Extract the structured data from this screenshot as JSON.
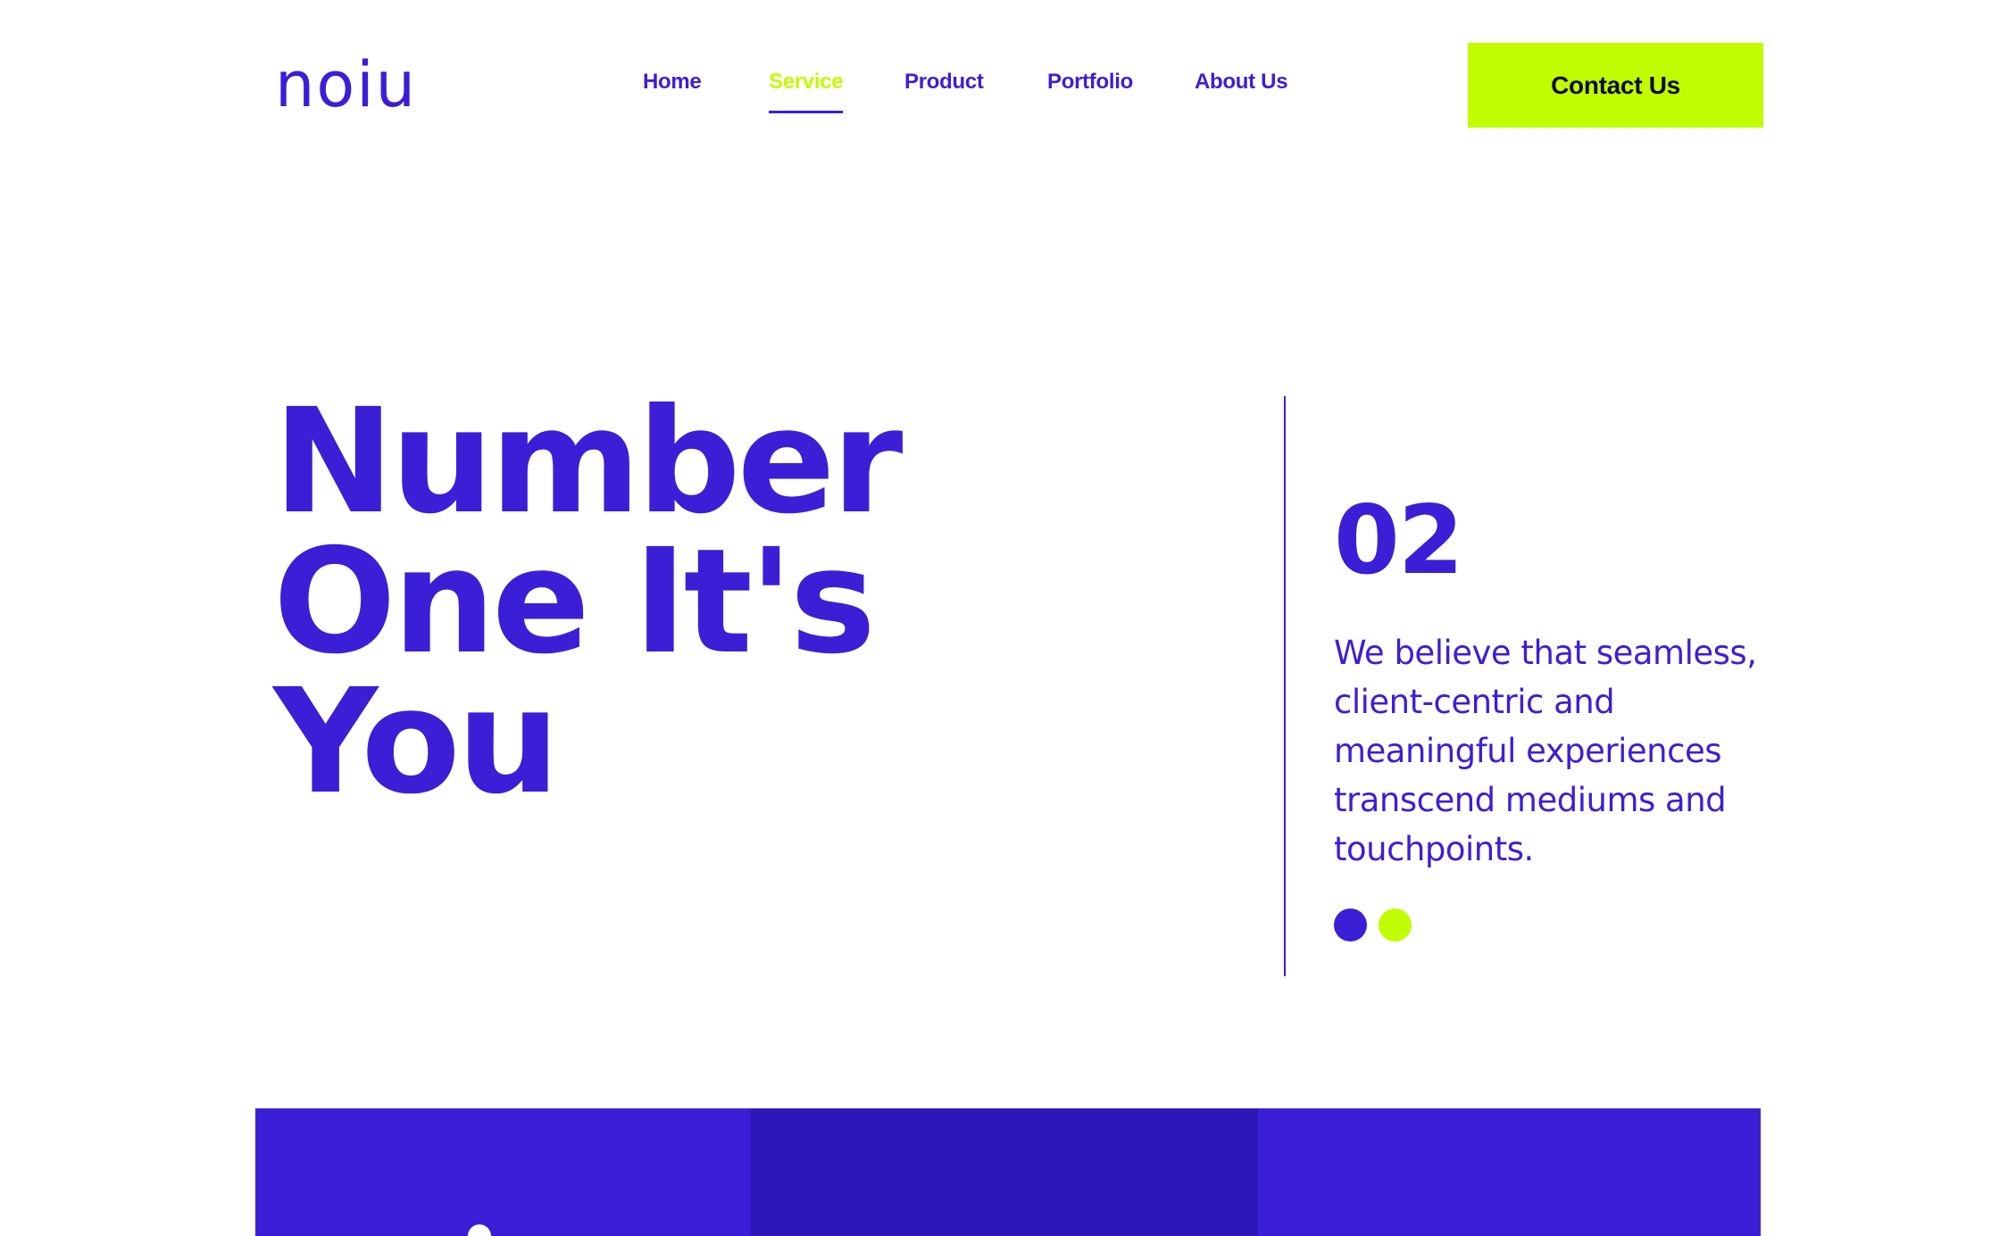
{
  "colors": {
    "primary": "#3b1fd6",
    "accent": "#c2fc00",
    "panel_dark": "#2e17b8",
    "background": "#ffffff"
  },
  "header": {
    "logo_text": "noiu",
    "nav": [
      {
        "label": "Home",
        "active": false
      },
      {
        "label": "Service",
        "active": true
      },
      {
        "label": "Product",
        "active": false
      },
      {
        "label": "Portfolio",
        "active": false
      },
      {
        "label": "About Us",
        "active": false
      }
    ],
    "contact_label": "Contact Us"
  },
  "hero": {
    "title_lines": [
      "Number",
      "One It's",
      "You"
    ],
    "slide_number": "02",
    "description": "We believe that seamless, client-centric and meaningful experiences transcend mediums and touchpoints.",
    "slider_dots": [
      {
        "color": "#3b1fd6",
        "active": true
      },
      {
        "color": "#c2fc00",
        "active": false
      }
    ]
  },
  "panels": [
    {
      "color": "#3b1fd6",
      "icon": "white-dot"
    },
    {
      "color": "#2e17b8",
      "icon": ""
    },
    {
      "color": "#3b1fd6",
      "icon": ""
    }
  ]
}
